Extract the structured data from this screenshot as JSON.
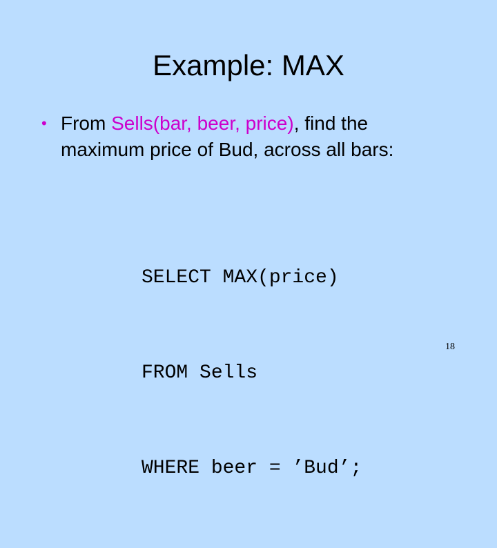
{
  "slide": {
    "title": "Example: MAX",
    "bullet": {
      "marker": "•",
      "prefix": "From ",
      "relation": "Sells(bar, beer, price)",
      "suffix_line1": ", find the",
      "line2": "maximum price of Bud, across all bars:"
    },
    "code": {
      "line1": "SELECT MAX(price)",
      "line2": "FROM Sells",
      "line3": "WHERE beer = ’Bud’;"
    },
    "page_number": "18"
  },
  "colors": {
    "background": "#BBDDFF",
    "text": "#000000",
    "accent": "#CC00CC"
  }
}
